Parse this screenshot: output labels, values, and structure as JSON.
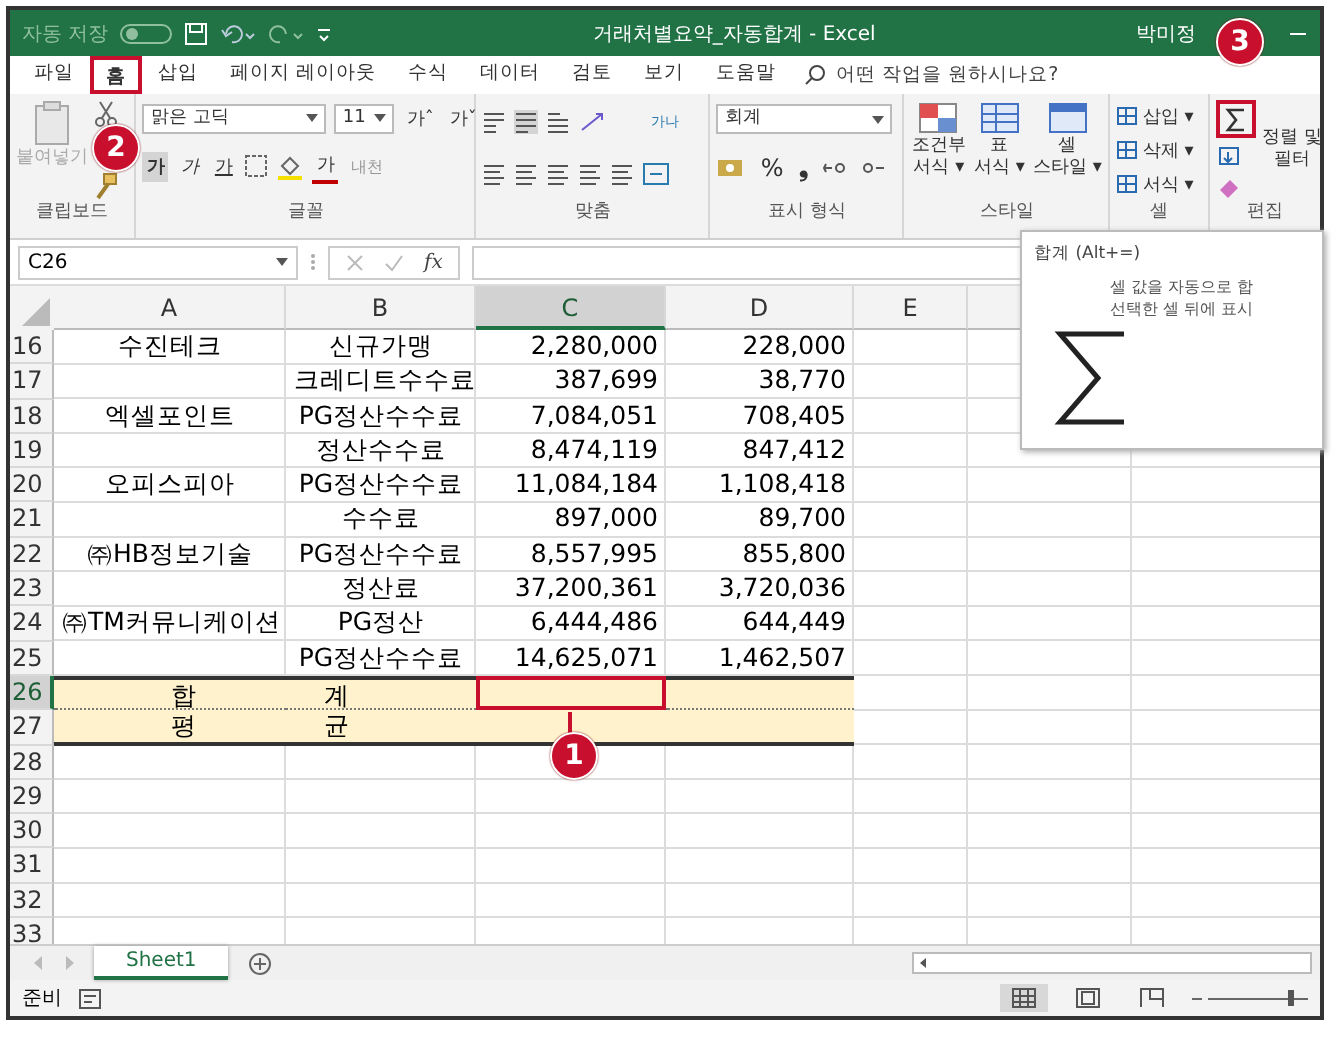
{
  "title_bar": {
    "autosave": {
      "label": "자동 저장",
      "on": false
    },
    "title": "거래처별요약_자동합계  -  Excel",
    "user": "박미정"
  },
  "menu_tabs": [
    {
      "label": "파일",
      "selected": false,
      "highlighted": false
    },
    {
      "label": "홈",
      "selected": true,
      "highlighted": true
    },
    {
      "label": "삽입",
      "selected": false,
      "highlighted": false
    },
    {
      "label": "페이지 레이아웃",
      "selected": false,
      "highlighted": false
    },
    {
      "label": "수식",
      "selected": false,
      "highlighted": false
    },
    {
      "label": "데이터",
      "selected": false,
      "highlighted": false
    },
    {
      "label": "검토",
      "selected": false,
      "highlighted": false
    },
    {
      "label": "보기",
      "selected": false,
      "highlighted": false
    },
    {
      "label": "도움말",
      "selected": false,
      "highlighted": false
    }
  ],
  "tell_me": {
    "placeholder": "어떤 작업을 원하시나요?"
  },
  "ribbon": {
    "clipboard": {
      "paste": "붙여넣기",
      "label": "클립보드"
    },
    "font": {
      "font_name": "맑은 고딕",
      "font_size": "11",
      "grow": "가ˆ",
      "shrink": "가ˇ",
      "bold": "가",
      "italic": "가",
      "underline": "가",
      "font_color": "가",
      "phonetic": "내천",
      "label": "글꼴"
    },
    "alignment": {
      "wrap": "가나",
      "label": "맞춤"
    },
    "number": {
      "format": "회계",
      "percent": "%",
      "comma": "❟",
      "label": "표시 형식"
    },
    "styles": {
      "buttons": [
        "조건부\n서식 ▾",
        "표\n서식 ▾",
        "셀\n스타일 ▾"
      ],
      "label": "스타일"
    },
    "cells": {
      "buttons": [
        "삽입 ▾",
        "삭제 ▾",
        "서식 ▾"
      ],
      "label": "셀"
    },
    "editing": {
      "sum_highlighted": true,
      "sort": "정렬 및\n필터",
      "label": "편집"
    }
  },
  "formula_bar": {
    "name_box": "C26",
    "fx": "fx"
  },
  "columns": [
    {
      "label": "A",
      "selected": false
    },
    {
      "label": "B",
      "selected": false
    },
    {
      "label": "C",
      "selected": true
    },
    {
      "label": "D",
      "selected": false
    },
    {
      "label": "E",
      "selected": false
    }
  ],
  "rows": [
    {
      "number": "16",
      "kind": "data",
      "selected": false,
      "cells": [
        "수진테크",
        "신규가맹",
        "2,280,000",
        "228,000"
      ]
    },
    {
      "number": "17",
      "kind": "data",
      "selected": false,
      "cells": [
        "",
        "크레디트수수료",
        "387,699",
        "38,770"
      ]
    },
    {
      "number": "18",
      "kind": "data",
      "selected": false,
      "cells": [
        "엑셀포인트",
        "PG정산수수료",
        "7,084,051",
        "708,405"
      ]
    },
    {
      "number": "19",
      "kind": "data",
      "selected": false,
      "cells": [
        "",
        "정산수수료",
        "8,474,119",
        "847,412"
      ]
    },
    {
      "number": "20",
      "kind": "data",
      "selected": false,
      "cells": [
        "오피스피아",
        "PG정산수수료",
        "11,084,184",
        "1,108,418"
      ]
    },
    {
      "number": "21",
      "kind": "data",
      "selected": false,
      "cells": [
        "",
        "수수료",
        "897,000",
        "89,700"
      ]
    },
    {
      "number": "22",
      "kind": "data",
      "selected": false,
      "cells": [
        "㈜HB정보기술",
        "PG정산수수료",
        "8,557,995",
        "855,800"
      ]
    },
    {
      "number": "23",
      "kind": "data",
      "selected": false,
      "cells": [
        "",
        "정산료",
        "37,200,361",
        "3,720,036"
      ]
    },
    {
      "number": "24",
      "kind": "data",
      "selected": false,
      "cells": [
        "㈜TM커뮤니케이션",
        "PG정산",
        "6,444,486",
        "644,449"
      ]
    },
    {
      "number": "25",
      "kind": "data",
      "selected": false,
      "cells": [
        "",
        "PG정산수수료",
        "14,625,071",
        "1,462,507"
      ]
    },
    {
      "number": "26",
      "kind": "total",
      "selected": true,
      "cells": [
        "합",
        "계",
        "",
        ""
      ]
    },
    {
      "number": "27",
      "kind": "total",
      "selected": false,
      "cells": [
        "평",
        "균",
        "",
        ""
      ]
    },
    {
      "number": "28",
      "kind": "empty",
      "selected": false,
      "cells": []
    },
    {
      "number": "29",
      "kind": "empty",
      "selected": false,
      "cells": []
    },
    {
      "number": "30",
      "kind": "empty",
      "selected": false,
      "cells": []
    },
    {
      "number": "31",
      "kind": "empty",
      "selected": false,
      "cells": []
    },
    {
      "number": "32",
      "kind": "empty",
      "selected": false,
      "cells": []
    },
    {
      "number": "33",
      "kind": "empty",
      "selected": false,
      "cells": []
    }
  ],
  "sheet_tabs": [
    {
      "label": "Sheet1",
      "selected": true
    }
  ],
  "status_bar": {
    "status": "준비",
    "zoom": {
      "level": 0.85
    }
  },
  "tooltip": {
    "title": "합계 (Alt+=)",
    "lines": [
      "셀 값을 자동으로 합",
      "선택한 셀 뒤에 표시"
    ]
  },
  "callouts": [
    "1",
    "2",
    "3"
  ]
}
